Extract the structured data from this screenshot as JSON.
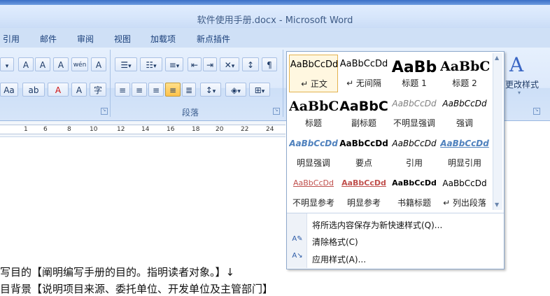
{
  "window": {
    "title": "软件使用手册.docx - Microsoft Word"
  },
  "tabs": [
    "引用",
    "邮件",
    "审阅",
    "视图",
    "加载项",
    "新点插件"
  ],
  "ribbon": {
    "paragraph_group_label": "段落",
    "font_group_buttons": [
      "A",
      "A",
      "A",
      "wén",
      "A"
    ],
    "font_row2": [
      "Aa",
      "ab",
      "A",
      "A",
      "字"
    ],
    "change_styles_label": "更改样式"
  },
  "ruler": {
    "ticks": [
      "1",
      "6",
      "8",
      "10",
      "12",
      "14",
      "16",
      "18",
      "20",
      "22",
      "24"
    ]
  },
  "styles_gallery": {
    "styles": [
      {
        "sample": "AaBbCcDd",
        "name": "↵ 正文",
        "selected": true
      },
      {
        "sample": "AaBbCcDd",
        "name": "↵ 无间隔"
      },
      {
        "sample": "AaBb",
        "name": "标题 1"
      },
      {
        "sample": "AaBbC",
        "name": "标题 2"
      },
      {
        "sample": "AaBbC",
        "name": "标题"
      },
      {
        "sample": "AaBbC",
        "name": "副标题"
      },
      {
        "sample": "AaBbCcDd",
        "name": "不明显强调"
      },
      {
        "sample": "AaBbCcDd",
        "name": "强调"
      },
      {
        "sample": "AaBbCcDd",
        "name": "明显强调"
      },
      {
        "sample": "AaBbCcDd",
        "name": "要点"
      },
      {
        "sample": "AaBbCcDd",
        "name": "引用"
      },
      {
        "sample": "AaBbCcDd",
        "name": "明显引用"
      },
      {
        "sample": "AaBbCcDd",
        "name": "不明显参考"
      },
      {
        "sample": "AaBbCcDd",
        "name": "明显参考"
      },
      {
        "sample": "AaBbCcDd",
        "name": "书籍标题"
      },
      {
        "sample": "AaBbCcDd",
        "name": "↵ 列出段落"
      }
    ],
    "menu": {
      "save_as_quick_style": "将所选内容保存为新快速样式(Q)...",
      "clear_formatting": "清除格式(C)",
      "apply_styles": "应用样式(A)..."
    }
  },
  "document": {
    "line1": "写目的【阐明编写手册的目的。指明读者对象。】↓",
    "line2": "目背景【说明项目来源、委托单位、开发单位及主管部门】"
  },
  "colors": {
    "accent": "#15428b",
    "selection": "#e3b24f"
  }
}
